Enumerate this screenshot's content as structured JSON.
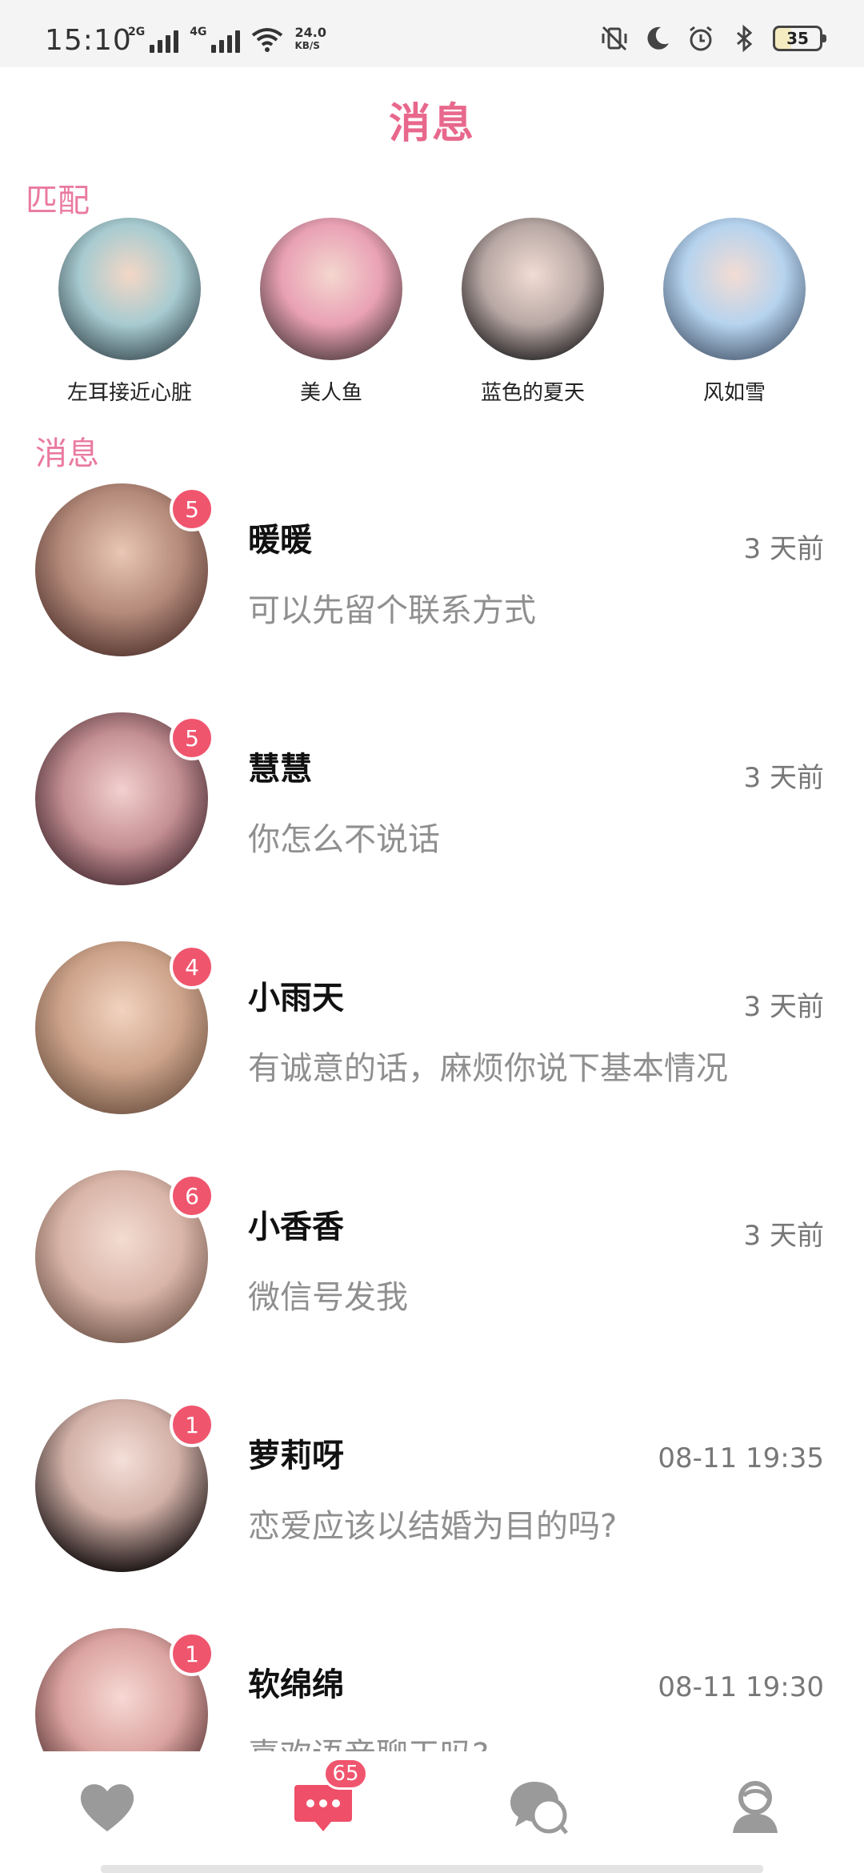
{
  "status_bar": {
    "time": "15:10",
    "network_1": "2G",
    "network_2": "4G",
    "speed_value": "24.0",
    "speed_unit": "KB/S",
    "battery": "35"
  },
  "header": {
    "title": "消息"
  },
  "sections": {
    "match_label": "匹配",
    "messages_label": "消息"
  },
  "matches": [
    {
      "name": "左耳接近心脏"
    },
    {
      "name": "美人鱼"
    },
    {
      "name": "蓝色的夏天"
    },
    {
      "name": "风如雪"
    }
  ],
  "conversations": [
    {
      "name": "暖暖",
      "preview": "可以先留个联系方式",
      "time": "3 天前",
      "unread": "5"
    },
    {
      "name": "慧慧",
      "preview": "你怎么不说话",
      "time": "3 天前",
      "unread": "5"
    },
    {
      "name": "小雨天",
      "preview": "有诚意的话，麻烦你说下基本情况",
      "time": "3 天前",
      "unread": "4"
    },
    {
      "name": "小香香",
      "preview": "微信号发我",
      "time": "3 天前",
      "unread": "6"
    },
    {
      "name": "萝莉呀",
      "preview": "恋爱应该以结婚为目的吗?",
      "time": "08-11 19:35",
      "unread": "1"
    },
    {
      "name": "软绵绵",
      "preview": "喜欢语音聊天吗?",
      "time": "08-11 19:30",
      "unread": "1"
    }
  ],
  "bottom_nav": {
    "items": [
      {
        "icon": "heart-icon"
      },
      {
        "icon": "message-icon",
        "badge": "65"
      },
      {
        "icon": "chat-bubbles-icon"
      },
      {
        "icon": "profile-icon"
      }
    ],
    "active_color": "#ef4f68",
    "inactive_color": "#9a9a9a"
  },
  "colors": {
    "accent": "#e8688c",
    "badge": "#f0556e"
  }
}
